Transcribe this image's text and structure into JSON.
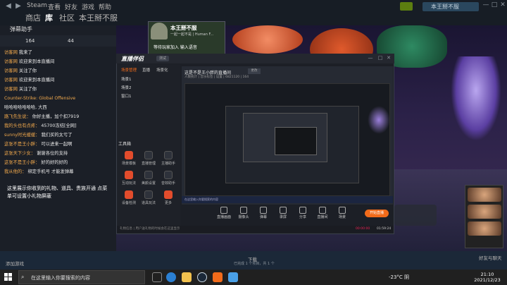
{
  "steam": {
    "menu": [
      "Steam",
      "查看",
      "好友",
      "游戏",
      "帮助"
    ],
    "tabs": [
      {
        "label": "商店"
      },
      {
        "label": "库"
      },
      {
        "label": "社区"
      },
      {
        "label": "本王掰不服"
      }
    ],
    "user": "本王掰不服",
    "add_game": "添加游戏",
    "download_label": "下载",
    "download_sub": "已完成 1 个项目，共 1 个",
    "friends_chat": "好友与聊天"
  },
  "chat": {
    "title": "弹幕助手",
    "stats": [
      "164",
      "44"
    ],
    "messages": [
      {
        "name": "访客网",
        "text": "我来了"
      },
      {
        "name": "访客网",
        "text": "欢迎来到本直播间"
      },
      {
        "name": "访客网",
        "text": "关注了你"
      },
      {
        "name": "访客网",
        "text": "欢迎来到本直播间"
      },
      {
        "name": "访客网",
        "text": "关注了你"
      },
      {
        "name": "Counter-Strike: Global Offensive",
        "text": ""
      },
      {
        "name": "",
        "text": "哈哈哈哈哈哈哈, 大西"
      },
      {
        "name": "路飞先生说：",
        "text": "你好主播，加个扣7919"
      },
      {
        "name": "我的头也有点疼：",
        "text": "45700冻结[全网]"
      },
      {
        "name": "sunny时光缓缓：",
        "text": "我们买的太亏了"
      },
      {
        "name": "这张不是王小胖：",
        "text": "可以进来一起啊"
      },
      {
        "name": "这张天下少女：",
        "text": "谢谢各位的支持"
      },
      {
        "name": "这张不是王小胖：",
        "text": "好的好的好的"
      },
      {
        "name": "我从他的：",
        "text": "绑定手机号 才能发弹幕"
      }
    ],
    "gift_note": "这里展示你收到的礼物、道具、贵族开通 点菜单可设置小礼物屏蔽"
  },
  "stream_scene": {
    "statue_name": "本王掰不服",
    "statue_sub": "一起一起不是 | Human F...",
    "statue_join": "等待玩家加入 输入语音"
  },
  "app": {
    "logo": "直播伴侣",
    "version": "测试",
    "side_tabs": [
      "场景管理",
      "直播",
      "场景化"
    ],
    "scenes": [
      "场景1",
      "场景2",
      "窗口1"
    ],
    "tools_label": "工具箱",
    "tools": [
      {
        "label": "场景模板",
        "red": true
      },
      {
        "label": "直播管理",
        "red": false
      },
      {
        "label": "主播助手",
        "red": false
      },
      {
        "label": "互动玩法",
        "red": true
      },
      {
        "label": "美颜设置",
        "red": false
      },
      {
        "label": "音效助手",
        "red": false
      },
      {
        "label": "设备检测",
        "red": true
      },
      {
        "label": "道具玩法",
        "red": false
      },
      {
        "label": "更多",
        "red": true
      }
    ],
    "preview_title": "这是不是王小胖的直播间",
    "preview_tag": "更改",
    "preview_meta": "人数统计 | 音乐标签 | 设置 | 6821120 | 164",
    "controls": [
      "直播画面",
      "摄像头",
      "弹幕",
      "录屏",
      "分享",
      "直播间",
      "场景"
    ],
    "start_live": "开始直播",
    "status": "礼物信息 | 用户送礼物的时候会在这里显示",
    "time_a": "00:00:00",
    "time_b": "01:59:24",
    "mini_taskbar": "在这里输入你要搜索的内容"
  },
  "taskbar": {
    "search_placeholder": "在这里输入你要搜索的内容",
    "weather": "-23°C 阴",
    "time": "21:10",
    "date": "2021/12/23"
  },
  "colors": {
    "accent": "#f26b1a",
    "steam_bar": "#171d25",
    "chat_name": "#f0a84c"
  }
}
